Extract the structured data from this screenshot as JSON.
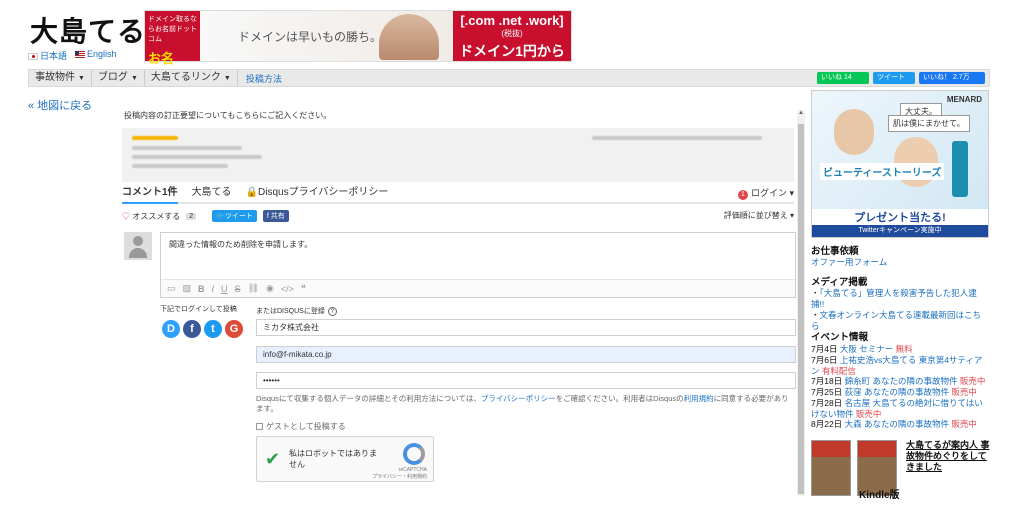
{
  "header": {
    "logo_text": "大島てる",
    "lang_ja": "日本語",
    "lang_en": "English",
    "banner": {
      "left_small": "ドメイン取るならお名前ドットコム",
      "left_brand": "お名前.com",
      "left_url": "https://www.onamae.com",
      "middle_text": "ドメインは早いもの勝ち。",
      "right_top": "[.com .net .work]",
      "right_main": "ドメイン1円から",
      "right_note": "(税抜)"
    }
  },
  "nav": {
    "items": [
      "事故物件",
      "ブログ",
      "大島てるリンク"
    ],
    "link": "投稿方法",
    "social": {
      "line": "いいね 14",
      "twitter": "ツイート",
      "facebook": "いいね！ 2.7万"
    }
  },
  "back_link": "« 地図に戻る",
  "comments": {
    "note": "投稿内容の訂正要望についてもこちらにご記入ください。",
    "tabs": [
      "コメント1件",
      "大島てる",
      "Disqusプライバシーポリシー"
    ],
    "login": "ログイン",
    "login_badge": "1",
    "recommend": "オススメする",
    "recommend_count": "2",
    "tweet": "ツイート",
    "share": "共有",
    "sort": "評価順に並び替え",
    "editor_text": "間違った情報のため削除を申請します。",
    "social_login_label": "下記でログインして投稿",
    "disqus_register": "またはDISQUSに登録",
    "name_value": "ミカタ株式会社",
    "email_value": "info@f-mikata.co.jp",
    "password_value": "••••••",
    "privacy_text_1": "Disqusにて収集する個人データの詳細とその利用方法については、",
    "privacy_link": "プライバシーポリシー",
    "privacy_text_2": "をご確認ください。利用者はDisqusの",
    "terms_link": "利用規約",
    "privacy_text_3": "に同意する必要があります。",
    "guest": "ゲストとして投稿する",
    "captcha_text": "私はロボットではありません",
    "captcha_brand": "reCAPTCHA",
    "captcha_links": "プライバシー・利用規約"
  },
  "sidebar": {
    "ad": {
      "brand": "MENARD",
      "bubble1": "大丈夫。",
      "bubble2": "肌は僕にまかせて。",
      "title": "ビューティーストーリーズ",
      "present": "プレゼント当たる!",
      "campaign": "Twitterキャンペーン実施中"
    },
    "job_heading": "お仕事依頼",
    "job_link": "オファー用フォーム",
    "media_heading": "メディア掲載",
    "media_items": [
      "「大島てる」管理人を殺害予告した犯人逮捕!!",
      "文春オンライン大島てる連載最新回はこちら"
    ],
    "events_heading": "イベント情報",
    "events": [
      {
        "date": "7月4日",
        "place": "大阪",
        "title": "セミナー",
        "status": "無料"
      },
      {
        "date": "7月6日",
        "place": "",
        "title": "上祐史浩vs大島てる 東京第4サティアン",
        "status": "有料配信"
      },
      {
        "date": "7月18日",
        "place": "錦糸町",
        "title": "あなたの隣の事故物件",
        "status": "販売中"
      },
      {
        "date": "7月25日",
        "place": "荻窪",
        "title": "あなたの隣の事故物件",
        "status": "販売中"
      },
      {
        "date": "7月28日",
        "place": "名古屋",
        "title": "大島てるの絶対に借りてはいけない物件",
        "status": "販売中"
      },
      {
        "date": "8月22日",
        "place": "大森",
        "title": "あなたの隣の事故物件",
        "status": "販売中"
      }
    ],
    "book_title": "大島てるが案内人 事故物件めぐりをしてきました",
    "kindle": "Kindle版"
  }
}
